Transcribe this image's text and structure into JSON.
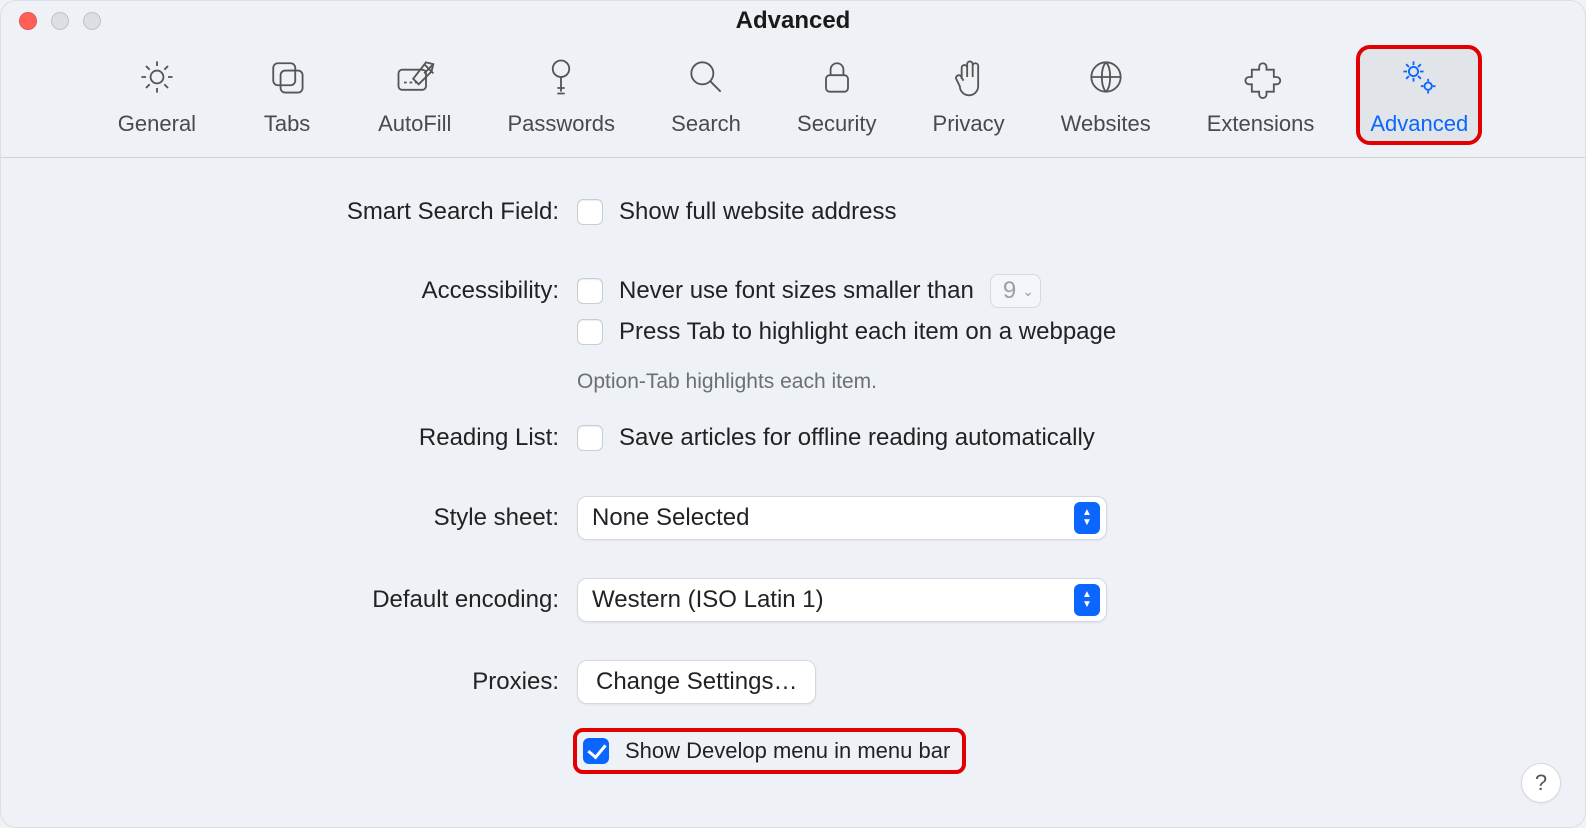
{
  "window": {
    "title": "Advanced"
  },
  "toolbar": {
    "items": [
      {
        "label": "General"
      },
      {
        "label": "Tabs"
      },
      {
        "label": "AutoFill"
      },
      {
        "label": "Passwords"
      },
      {
        "label": "Search"
      },
      {
        "label": "Security"
      },
      {
        "label": "Privacy"
      },
      {
        "label": "Websites"
      },
      {
        "label": "Extensions"
      },
      {
        "label": "Advanced"
      }
    ]
  },
  "sections": {
    "smart_search": {
      "label": "Smart Search Field:",
      "option": "Show full website address"
    },
    "accessibility": {
      "label": "Accessibility:",
      "opt_font": "Never use font sizes smaller than",
      "font_value": "9",
      "opt_tab": "Press Tab to highlight each item on a webpage",
      "hint": "Option-Tab highlights each item."
    },
    "reading_list": {
      "label": "Reading List:",
      "option": "Save articles for offline reading automatically"
    },
    "style_sheet": {
      "label": "Style sheet:",
      "value": "None Selected"
    },
    "encoding": {
      "label": "Default encoding:",
      "value": "Western (ISO Latin 1)"
    },
    "proxies": {
      "label": "Proxies:",
      "button": "Change Settings…"
    },
    "develop": {
      "label": "Show Develop menu in menu bar",
      "checked": true
    }
  },
  "help": "?"
}
